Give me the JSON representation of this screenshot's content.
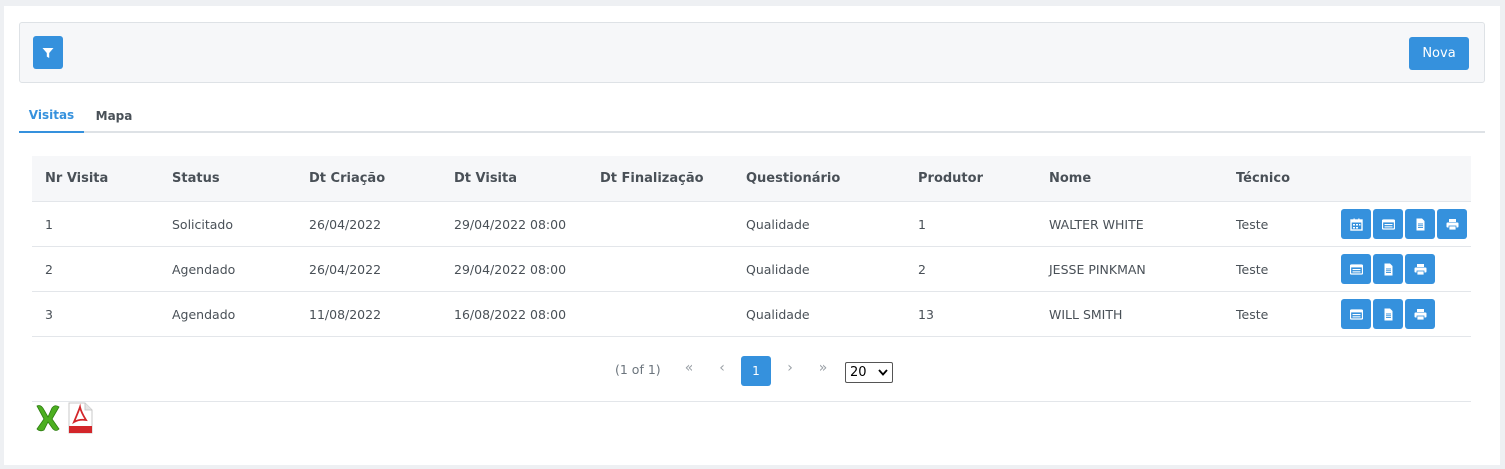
{
  "toolbar": {
    "filter_icon": "filter-icon",
    "nova_label": "Nova"
  },
  "tabs": [
    {
      "label": "Visitas",
      "active": true
    },
    {
      "label": "Mapa",
      "active": false
    }
  ],
  "table": {
    "columns": [
      "Nr Visita",
      "Status",
      "Dt Criação",
      "Dt Visita",
      "Dt Finalização",
      "Questionário",
      "Produtor",
      "Nome",
      "Técnico"
    ],
    "rows": [
      {
        "nr": "1",
        "status": "Solicitado",
        "dt_criacao": "26/04/2022",
        "dt_visita": "29/04/2022 08:00",
        "dt_finalizacao": "",
        "questionario": "Qualidade",
        "produtor": "1",
        "nome": "WALTER WHITE",
        "tecnico": "Teste",
        "actions": [
          "calendar-icon",
          "list-icon",
          "document-icon",
          "print-icon"
        ]
      },
      {
        "nr": "2",
        "status": "Agendado",
        "dt_criacao": "26/04/2022",
        "dt_visita": "29/04/2022 08:00",
        "dt_finalizacao": "",
        "questionario": "Qualidade",
        "produtor": "2",
        "nome": "JESSE PINKMAN",
        "tecnico": "Teste",
        "actions": [
          "list-icon",
          "document-icon",
          "print-icon"
        ]
      },
      {
        "nr": "3",
        "status": "Agendado",
        "dt_criacao": "11/08/2022",
        "dt_visita": "16/08/2022 08:00",
        "dt_finalizacao": "",
        "questionario": "Qualidade",
        "produtor": "13",
        "nome": "WILL SMITH",
        "tecnico": "Teste",
        "actions": [
          "list-icon",
          "document-icon",
          "print-icon"
        ]
      }
    ]
  },
  "pagination": {
    "info": "(1 of 1)",
    "first": "«",
    "prev": "‹",
    "current": "1",
    "next": "›",
    "last": "»",
    "rows_per_page": "20"
  },
  "export": {
    "excel_icon": "excel-icon",
    "pdf_icon": "pdf-icon"
  },
  "colors": {
    "accent": "#3591dd",
    "header_bg": "#f6f7f9",
    "border": "#dee2e6"
  }
}
